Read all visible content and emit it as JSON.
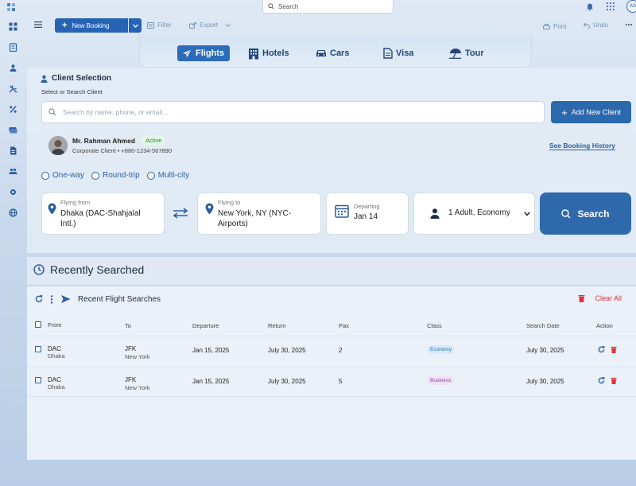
{
  "topbar": {
    "search_placeholder": "Search",
    "user_initials": "AS"
  },
  "toolbar": {
    "new_booking": "New Booking",
    "filter": "Filter",
    "export": "Export",
    "print": "Print",
    "undo": "Undo"
  },
  "tabs": [
    {
      "label": "Flights",
      "icon": "plane-icon",
      "active": true
    },
    {
      "label": "Hotels",
      "icon": "building-icon",
      "active": false
    },
    {
      "label": "Cars",
      "icon": "car-icon",
      "active": false
    },
    {
      "label": "Visa",
      "icon": "document-icon",
      "active": false
    },
    {
      "label": "Tour",
      "icon": "beach-umbrella-icon",
      "active": false
    }
  ],
  "client": {
    "section_title": "Client Selection",
    "section_subtitle": "Select or Search Client",
    "search_placeholder": "Search by name, phone, or email...",
    "add_button": "Add New Client",
    "name": "Mr. Rahman Ahmed",
    "status": "Active",
    "meta": "Corporate Client • +880-1234-567890",
    "history_link": "See Booking History"
  },
  "trip_types": [
    "One-way",
    "Round-trip",
    "Multi-city"
  ],
  "search_form": {
    "from_label": "Flying from",
    "from_value_line1": "Dhaka (DAC-Shahjalal",
    "from_value_line2": "Intl.)",
    "to_label": "Flying to",
    "to_value_line1": "New York, NY (NYC-",
    "to_value_line2": "Airports)",
    "depart_label": "Departing",
    "depart_value": "Jan 14",
    "passengers": "1 Adult, Economy",
    "search_button": "Search"
  },
  "recent": {
    "title": "Recently Searched",
    "subtitle": "Recent Flight Searches",
    "clear_all": "Clear All",
    "columns": [
      "From",
      "To",
      "Departure",
      "Return",
      "Pax",
      "Class",
      "Search Date",
      "Action"
    ],
    "rows": [
      {
        "from_code": "DAC",
        "from_city": "Dhaka",
        "to_code": "JFK",
        "to_city": "New York",
        "departure": "Jan 15, 2025",
        "return": "July 30, 2025",
        "pax": "2",
        "class": "Economy",
        "search_date": "July 30, 2025"
      },
      {
        "from_code": "DAC",
        "from_city": "Dhaka",
        "to_code": "JFK",
        "to_city": "New York",
        "departure": "Jan 15, 2025",
        "return": "July 30, 2025",
        "pax": "5",
        "class": "Business",
        "search_date": "July 30, 2025"
      }
    ]
  },
  "colors": {
    "primary": "#2563b5",
    "link": "#2a5f9e",
    "danger": "#e0323a",
    "active_green": "#1f8a3a"
  }
}
